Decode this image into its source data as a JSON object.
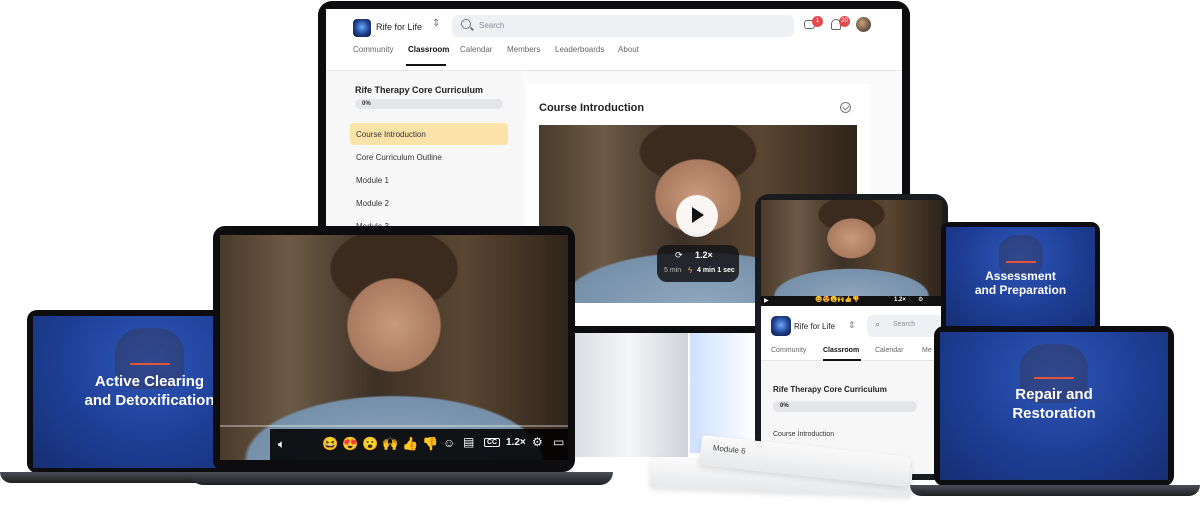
{
  "app": {
    "name": "Rife for Life",
    "search_placeholder": "Search",
    "chat_badge": "1",
    "notif_badge": "20",
    "nav": [
      "Community",
      "Classroom",
      "Calendar",
      "Members",
      "Leaderboards",
      "About"
    ]
  },
  "course": {
    "title": "Rife Therapy Core Curriculum",
    "progress_label": "0%",
    "progress": 0,
    "lessons": [
      "Course Introduction",
      "Core Curriculum Outline",
      "Module 1",
      "Module 2",
      "Module 3"
    ],
    "active_lesson": "Course Introduction"
  },
  "lesson_view": {
    "title": "Course Introduction"
  },
  "video": {
    "speed": "1.2×",
    "time_short": "5 min",
    "time_long": "4 min 1 sec",
    "reactions": [
      "😆",
      "😍",
      "😮",
      "🙌",
      "👍",
      "👎"
    ],
    "cc_label": "CC"
  },
  "tablet": {
    "app_name": "Rife for Life",
    "search_placeholder": "Search",
    "nav": [
      "Community",
      "Classroom",
      "Calendar",
      "Me"
    ],
    "course_title": "Rife Therapy Core Curriculum",
    "progress_label": "0%",
    "lesson": "Course Introduction"
  },
  "slides": {
    "left_laptop": [
      "Active Clearing",
      "and Detoxification"
    ],
    "right_top": [
      "Assessment",
      "and Preparation"
    ],
    "right_bottom": [
      "Repair and",
      "Restoration"
    ]
  },
  "paper": {
    "label": "Module 6"
  },
  "colors": {
    "accent": "#f3c766",
    "active_row": "#fbe3a8",
    "slide_blue": "#1e3e95",
    "slide_rule": "#e0533d",
    "badge": "#e5484d"
  }
}
